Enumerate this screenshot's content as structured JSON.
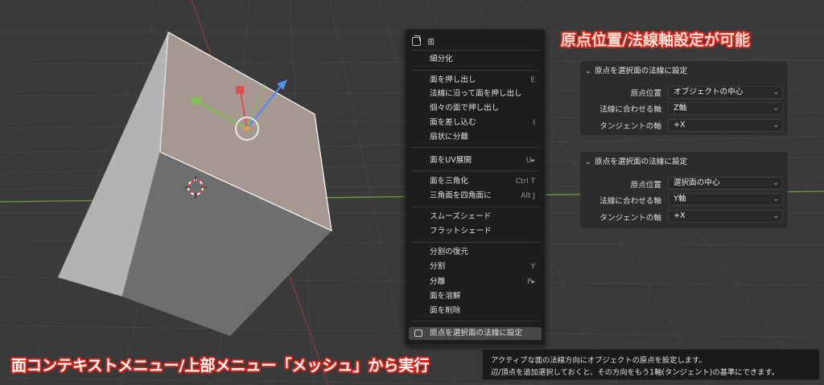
{
  "colors": {
    "accent_red": "#d9261c",
    "menu_bg": "#1d1d1d",
    "panel_bg": "#2c2c2c",
    "highlight": "#474747"
  },
  "menu": {
    "header": "面",
    "header_icon": "face-select-icon",
    "items": [
      {
        "label": "細分化",
        "shortcut": ""
      },
      {
        "label": "面を押し出し",
        "shortcut": "E"
      },
      {
        "label": "法線に沿って面を押し出し",
        "shortcut": ""
      },
      {
        "label": "個々の面で押し出し",
        "shortcut": ""
      },
      {
        "label": "面を差し込む",
        "shortcut": "I"
      },
      {
        "label": "扇状に分離",
        "shortcut": ""
      },
      {
        "label": "面をUV展開",
        "shortcut": "U▸"
      },
      {
        "label": "面を三角化",
        "shortcut": "Ctrl T"
      },
      {
        "label": "三角面を四角面に",
        "shortcut": "Alt J"
      },
      {
        "label": "スムーズシェード",
        "shortcut": ""
      },
      {
        "label": "フラットシェード",
        "shortcut": ""
      },
      {
        "label": "分割の復元",
        "shortcut": ""
      },
      {
        "label": "分割",
        "shortcut": "Y"
      },
      {
        "label": "分離",
        "shortcut": "P▸"
      },
      {
        "label": "面を溶解",
        "shortcut": ""
      },
      {
        "label": "面を削除",
        "shortcut": ""
      },
      {
        "label": "原点を選択面の法線に設定",
        "shortcut": "",
        "icon": "set-origin-icon"
      }
    ]
  },
  "overlay": {
    "title": "原点位置/法線軸設定が可能",
    "bottom": "面コンテキストメニュー/上部メニュー「メッシュ」から実行"
  },
  "panels": [
    {
      "title": "原点を選択面の法線に設定",
      "rows": [
        {
          "label": "原点位置",
          "value": "オブジェクトの中心"
        },
        {
          "label": "法線に合わせる軸",
          "value": "Z軸"
        },
        {
          "label": "タンジェントの軸",
          "value": "+X"
        }
      ]
    },
    {
      "title": "原点を選択面の法線に設定",
      "rows": [
        {
          "label": "原点位置",
          "value": "選択面の中心"
        },
        {
          "label": "法線に合わせる軸",
          "value": "Y軸"
        },
        {
          "label": "タンジェントの軸",
          "value": "+X"
        }
      ]
    }
  ],
  "tooltip": {
    "line1": "アクティブな面の法線方向にオブジェクトの原点を設定します。",
    "line2": "辺/頂点を追加選択しておくと、その方向をもう1軸(タンジェント)の基準にできます。"
  }
}
